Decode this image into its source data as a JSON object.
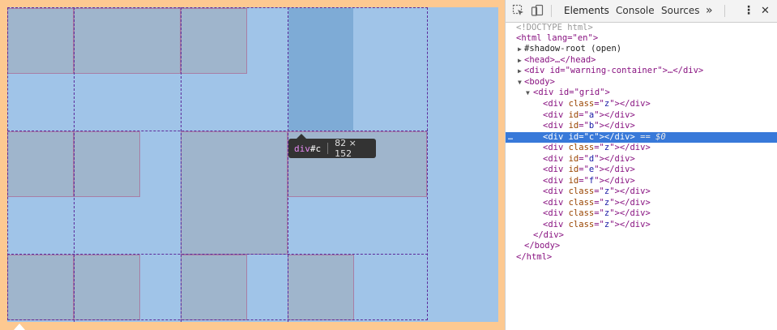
{
  "tooltip": {
    "tag": "div",
    "id": "#c",
    "dims": "82 × 152"
  },
  "devtools": {
    "tabs": [
      "Elements",
      "Console",
      "Sources"
    ],
    "more": "»",
    "menu": "⋮",
    "close": "✕",
    "dom": {
      "doctype": "<!DOCTYPE html>",
      "html_open": "<html lang=\"en\">",
      "shadow": "#shadow-root (open)",
      "head": "<head>…</head>",
      "warning": "<div id=\"warning-container\">…</div>",
      "body_open": "<body>",
      "grid_open": "<div id=\"grid\">",
      "children": [
        {
          "attr": "class",
          "val": "z"
        },
        {
          "attr": "id",
          "val": "a"
        },
        {
          "attr": "id",
          "val": "b"
        },
        {
          "attr": "id",
          "val": "c"
        },
        {
          "attr": "class",
          "val": "z"
        },
        {
          "attr": "id",
          "val": "d"
        },
        {
          "attr": "id",
          "val": "e"
        },
        {
          "attr": "id",
          "val": "f"
        },
        {
          "attr": "class",
          "val": "z"
        },
        {
          "attr": "class",
          "val": "z"
        },
        {
          "attr": "class",
          "val": "z"
        },
        {
          "attr": "class",
          "val": "z"
        }
      ],
      "selected_suffix": "== $0",
      "grid_close": "</div>",
      "body_close": "</body>",
      "html_close": "</html>"
    }
  }
}
